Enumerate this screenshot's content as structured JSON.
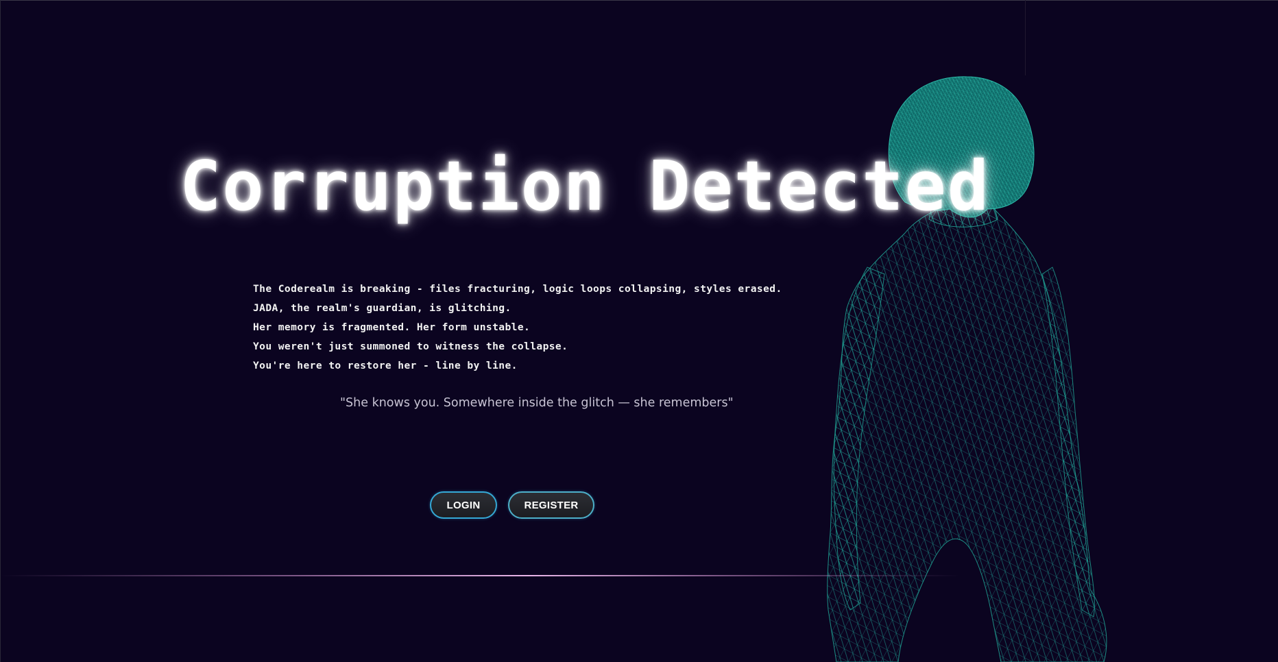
{
  "hero": {
    "title": "Corruption Detected"
  },
  "lore": {
    "lines": [
      "The Coderealm is breaking - files fracturing, logic loops collapsing, styles erased.",
      "JADA, the realm's guardian, is glitching.",
      "Her memory is fragmented. Her form unstable.",
      "You weren't just summoned to witness the collapse.",
      "You're here to restore her - line by line."
    ]
  },
  "quote": {
    "text": "\"She knows you. Somewhere inside the glitch — she remembers\""
  },
  "actions": {
    "login_label": "LOGIN",
    "register_label": "REGISTER"
  },
  "colors": {
    "background": "#0b0420",
    "wireframe": "#1fa79a",
    "button_border": "#35a9d6",
    "divider": "#e9b6e9"
  },
  "icons": {
    "figure": "wireframe-character-icon"
  }
}
